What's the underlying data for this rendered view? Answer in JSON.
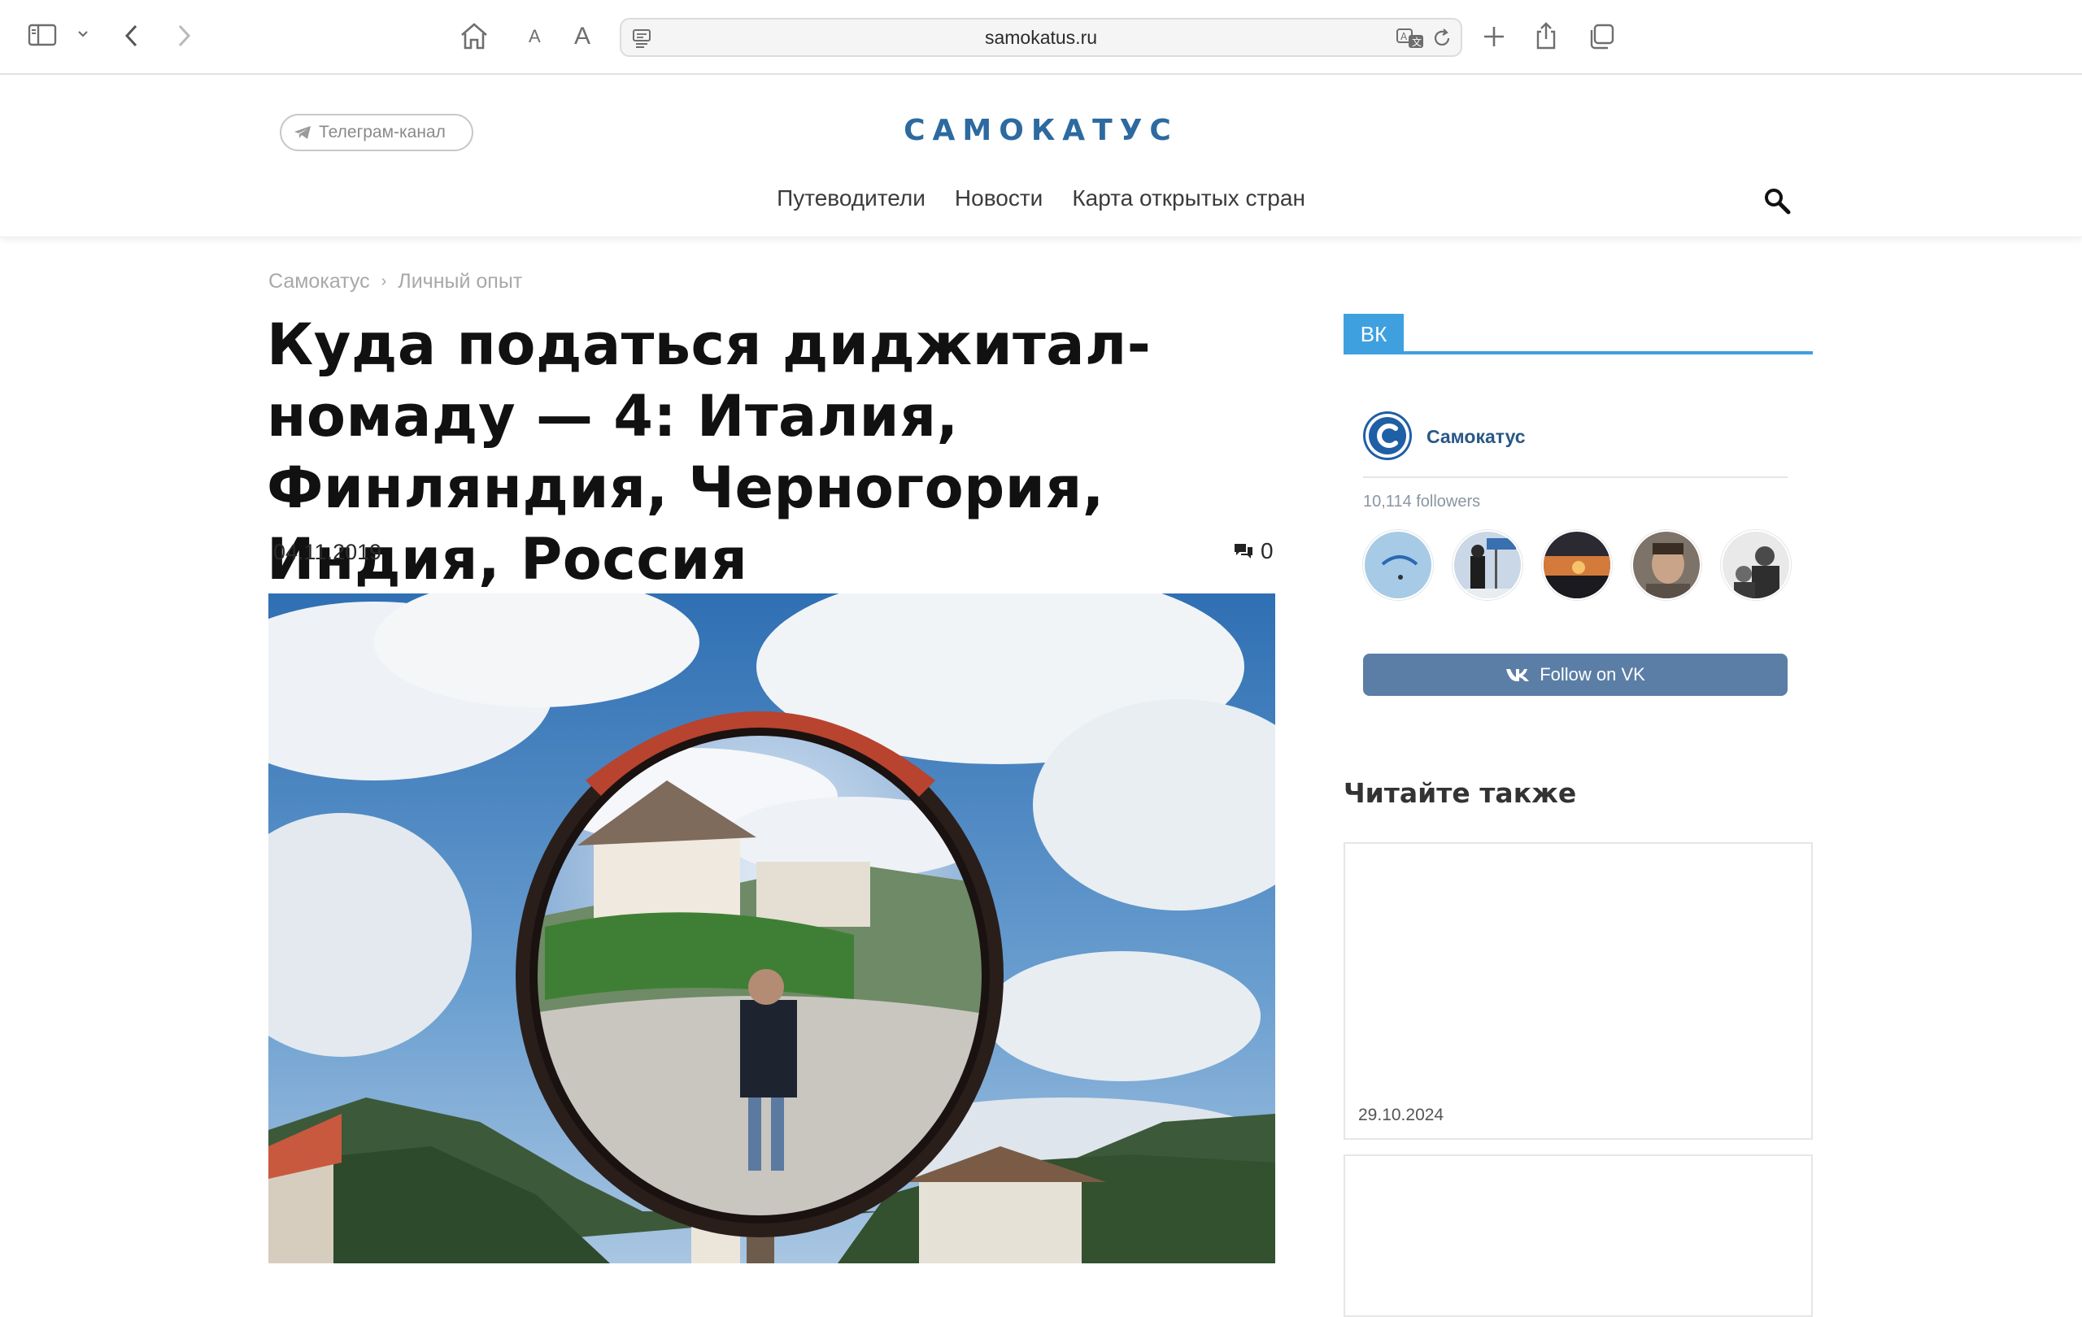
{
  "browser": {
    "url": "samokatus.ru",
    "font_small_label": "A",
    "font_large_label": "A"
  },
  "site": {
    "logo": "САМОКАТУС",
    "telegram_label": "Телеграм-канал",
    "nav": [
      "Путеводители",
      "Новости",
      "Карта открытых стран"
    ]
  },
  "article": {
    "breadcrumb": [
      "Самокатус",
      "Личный опыт"
    ],
    "breadcrumb_sep": "›",
    "title": "Куда податься диджитал-номаду — 4: Италия, Финляндия, Черногория, Индия, Россия",
    "date": "04.11.2019",
    "comments_count": "0"
  },
  "sidebar": {
    "vk_tab": "ВК",
    "vk_group_name": "Самокатус",
    "vk_followers": "10,114 followers",
    "vk_follow_label": "Follow on VK",
    "read_also_title": "Читайте также",
    "cards": [
      {
        "date": "29.10.2024"
      },
      {
        "date": ""
      }
    ]
  },
  "colors": {
    "brand": "#2c6aa0",
    "vk_tab": "#3ea0df",
    "vk_button": "#5b7ea6"
  }
}
